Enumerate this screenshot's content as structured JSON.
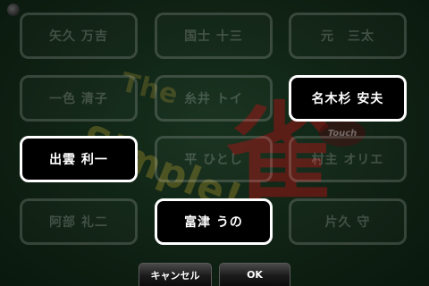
{
  "logo": {
    "the": "The",
    "simple": "Simple!",
    "kanji": "雀",
    "touch": "Touch"
  },
  "names": [
    {
      "label": "矢久 万吉",
      "selected": false
    },
    {
      "label": "国士 十三",
      "selected": false
    },
    {
      "label": "元　三太",
      "selected": false
    },
    {
      "label": "一色 清子",
      "selected": false
    },
    {
      "label": "糸井 トイ",
      "selected": false
    },
    {
      "label": "名木杉 安夫",
      "selected": true
    },
    {
      "label": "出雲 利一",
      "selected": true
    },
    {
      "label": "平 ひとし",
      "selected": false
    },
    {
      "label": "村主 オリエ",
      "selected": false
    },
    {
      "label": "阿部 礼二",
      "selected": false
    },
    {
      "label": "富津 うの",
      "selected": true
    },
    {
      "label": "片久 守",
      "selected": false
    }
  ],
  "buttons": {
    "cancel": "キャンセル",
    "ok": "OK"
  }
}
